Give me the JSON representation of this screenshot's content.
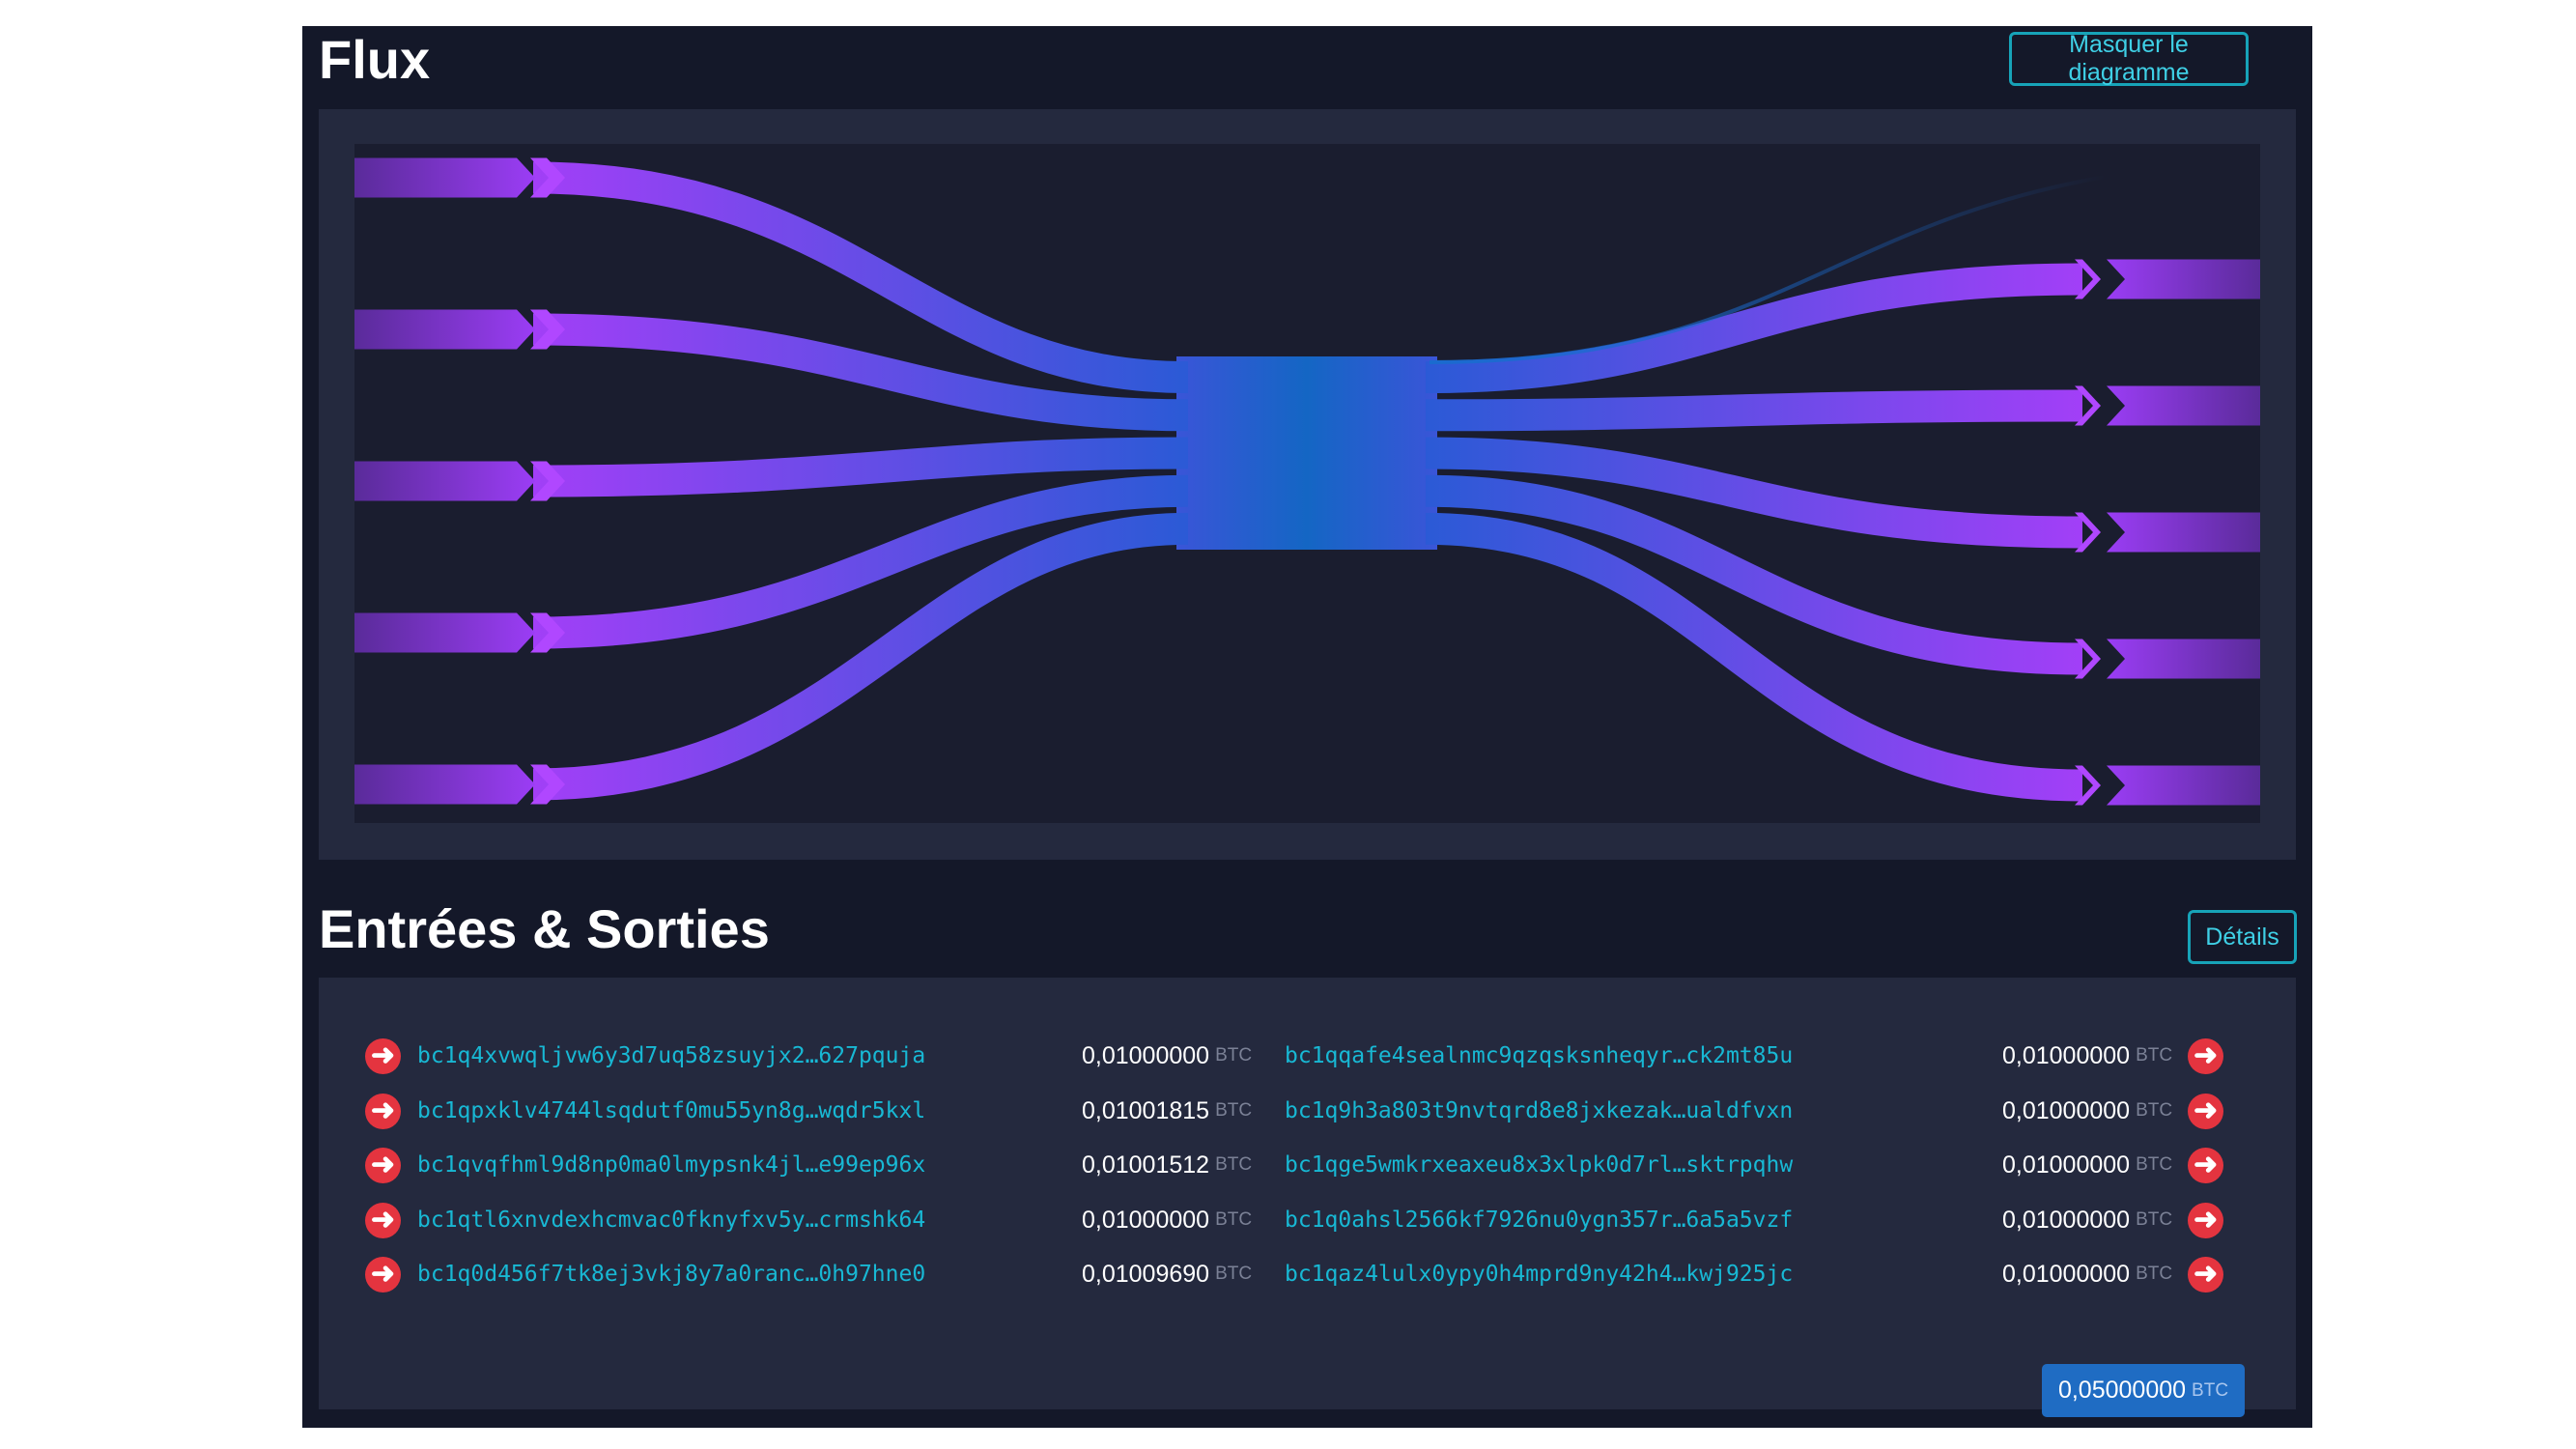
{
  "header": {
    "title": "Flux",
    "hide_button": "Masquer le diagramme"
  },
  "section": {
    "title": "Entrées & Sorties",
    "details_button": "Détails"
  },
  "colors": {
    "background": "#141829",
    "panel": "#24293e",
    "accent": "#17a3b8",
    "flow_purple": "#9b3df5",
    "flow_blue": "#1a6bcf",
    "arrow_red": "#e4343f",
    "total_badge": "#1f6cc3"
  },
  "currency": "BTC",
  "inputs": [
    {
      "address": "bc1q4xvwqljvw6y3d7uq58zsuyjx2…627pquja",
      "amount": "0,01000000",
      "unit": "BTC",
      "icon": "arrow-right-circle-icon"
    },
    {
      "address": "bc1qpxklv4744lsqdutf0mu55yn8g…wqdr5kxl",
      "amount": "0,01001815",
      "unit": "BTC",
      "icon": "arrow-right-circle-icon"
    },
    {
      "address": "bc1qvqfhml9d8np0ma0lmypsnk4jl…e99ep96x",
      "amount": "0,01001512",
      "unit": "BTC",
      "icon": "arrow-right-circle-icon"
    },
    {
      "address": "bc1qtl6xnvdexhcmvac0fknyfxv5y…crmshk64",
      "amount": "0,01000000",
      "unit": "BTC",
      "icon": "arrow-right-circle-icon"
    },
    {
      "address": "bc1q0d456f7tk8ej3vkj8y7a0ranc…0h97hne0",
      "amount": "0,01009690",
      "unit": "BTC",
      "icon": "arrow-right-circle-icon"
    }
  ],
  "outputs": [
    {
      "address": "bc1qqafe4sealnmc9qzqsksnheqyr…ck2mt85u",
      "amount": "0,01000000",
      "unit": "BTC",
      "icon": "arrow-right-circle-icon"
    },
    {
      "address": "bc1q9h3a803t9nvtqrd8e8jxkezak…ualdfvxn",
      "amount": "0,01000000",
      "unit": "BTC",
      "icon": "arrow-right-circle-icon"
    },
    {
      "address": "bc1qge5wmkrxeaxeu8x3xlpk0d7rl…sktrpqhw",
      "amount": "0,01000000",
      "unit": "BTC",
      "icon": "arrow-right-circle-icon"
    },
    {
      "address": "bc1q0ahsl2566kf7926nu0ygn357r…6a5a5vzf",
      "amount": "0,01000000",
      "unit": "BTC",
      "icon": "arrow-right-circle-icon"
    },
    {
      "address": "bc1qaz4lulx0ypy0h4mprd9ny42h4…kwj925jc",
      "amount": "0,01000000",
      "unit": "BTC",
      "icon": "arrow-right-circle-icon"
    }
  ],
  "total": {
    "amount": "0,05000000",
    "unit": "BTC"
  },
  "flow_diagram": {
    "input_count": 5,
    "output_count": 5,
    "has_fee_stream": true
  }
}
